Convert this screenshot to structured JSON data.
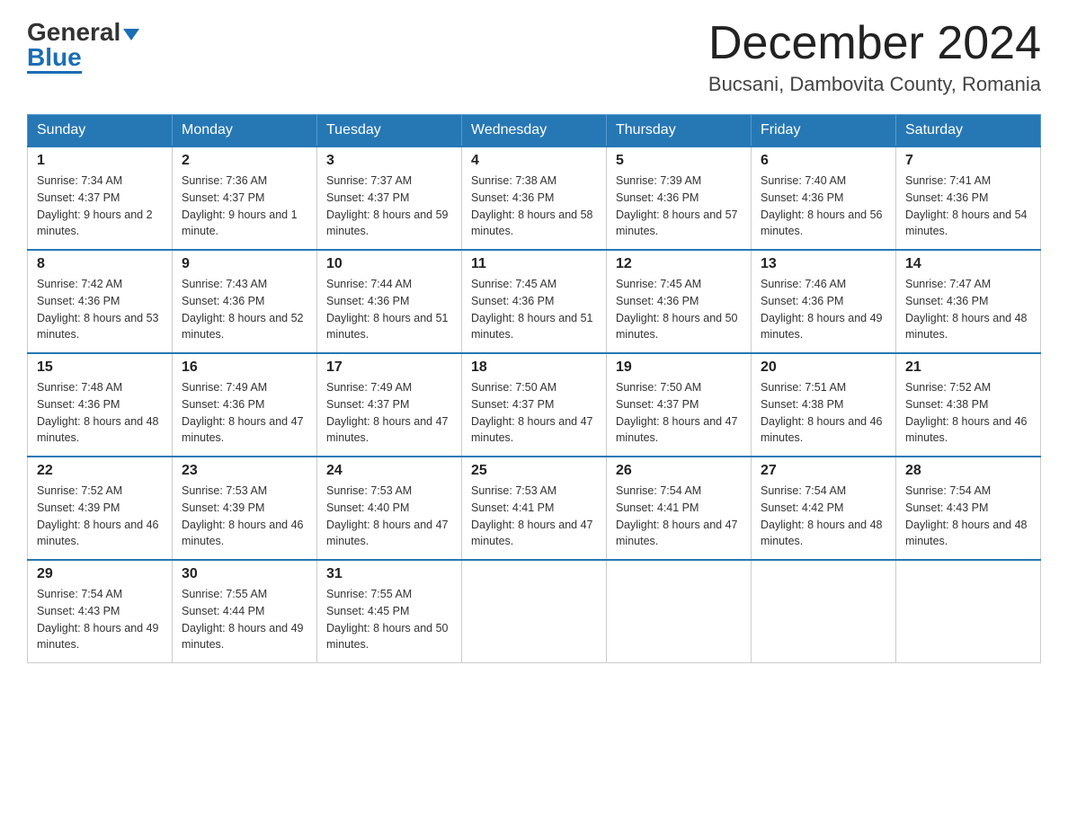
{
  "header": {
    "logo_general": "General",
    "logo_blue": "Blue",
    "month_title": "December 2024",
    "location": "Bucsani, Dambovita County, Romania"
  },
  "days_of_week": [
    "Sunday",
    "Monday",
    "Tuesday",
    "Wednesday",
    "Thursday",
    "Friday",
    "Saturday"
  ],
  "weeks": [
    [
      {
        "day": "1",
        "sunrise": "7:34 AM",
        "sunset": "4:37 PM",
        "daylight": "9 hours and 2 minutes."
      },
      {
        "day": "2",
        "sunrise": "7:36 AM",
        "sunset": "4:37 PM",
        "daylight": "9 hours and 1 minute."
      },
      {
        "day": "3",
        "sunrise": "7:37 AM",
        "sunset": "4:37 PM",
        "daylight": "8 hours and 59 minutes."
      },
      {
        "day": "4",
        "sunrise": "7:38 AM",
        "sunset": "4:36 PM",
        "daylight": "8 hours and 58 minutes."
      },
      {
        "day": "5",
        "sunrise": "7:39 AM",
        "sunset": "4:36 PM",
        "daylight": "8 hours and 57 minutes."
      },
      {
        "day": "6",
        "sunrise": "7:40 AM",
        "sunset": "4:36 PM",
        "daylight": "8 hours and 56 minutes."
      },
      {
        "day": "7",
        "sunrise": "7:41 AM",
        "sunset": "4:36 PM",
        "daylight": "8 hours and 54 minutes."
      }
    ],
    [
      {
        "day": "8",
        "sunrise": "7:42 AM",
        "sunset": "4:36 PM",
        "daylight": "8 hours and 53 minutes."
      },
      {
        "day": "9",
        "sunrise": "7:43 AM",
        "sunset": "4:36 PM",
        "daylight": "8 hours and 52 minutes."
      },
      {
        "day": "10",
        "sunrise": "7:44 AM",
        "sunset": "4:36 PM",
        "daylight": "8 hours and 51 minutes."
      },
      {
        "day": "11",
        "sunrise": "7:45 AM",
        "sunset": "4:36 PM",
        "daylight": "8 hours and 51 minutes."
      },
      {
        "day": "12",
        "sunrise": "7:45 AM",
        "sunset": "4:36 PM",
        "daylight": "8 hours and 50 minutes."
      },
      {
        "day": "13",
        "sunrise": "7:46 AM",
        "sunset": "4:36 PM",
        "daylight": "8 hours and 49 minutes."
      },
      {
        "day": "14",
        "sunrise": "7:47 AM",
        "sunset": "4:36 PM",
        "daylight": "8 hours and 48 minutes."
      }
    ],
    [
      {
        "day": "15",
        "sunrise": "7:48 AM",
        "sunset": "4:36 PM",
        "daylight": "8 hours and 48 minutes."
      },
      {
        "day": "16",
        "sunrise": "7:49 AM",
        "sunset": "4:36 PM",
        "daylight": "8 hours and 47 minutes."
      },
      {
        "day": "17",
        "sunrise": "7:49 AM",
        "sunset": "4:37 PM",
        "daylight": "8 hours and 47 minutes."
      },
      {
        "day": "18",
        "sunrise": "7:50 AM",
        "sunset": "4:37 PM",
        "daylight": "8 hours and 47 minutes."
      },
      {
        "day": "19",
        "sunrise": "7:50 AM",
        "sunset": "4:37 PM",
        "daylight": "8 hours and 47 minutes."
      },
      {
        "day": "20",
        "sunrise": "7:51 AM",
        "sunset": "4:38 PM",
        "daylight": "8 hours and 46 minutes."
      },
      {
        "day": "21",
        "sunrise": "7:52 AM",
        "sunset": "4:38 PM",
        "daylight": "8 hours and 46 minutes."
      }
    ],
    [
      {
        "day": "22",
        "sunrise": "7:52 AM",
        "sunset": "4:39 PM",
        "daylight": "8 hours and 46 minutes."
      },
      {
        "day": "23",
        "sunrise": "7:53 AM",
        "sunset": "4:39 PM",
        "daylight": "8 hours and 46 minutes."
      },
      {
        "day": "24",
        "sunrise": "7:53 AM",
        "sunset": "4:40 PM",
        "daylight": "8 hours and 47 minutes."
      },
      {
        "day": "25",
        "sunrise": "7:53 AM",
        "sunset": "4:41 PM",
        "daylight": "8 hours and 47 minutes."
      },
      {
        "day": "26",
        "sunrise": "7:54 AM",
        "sunset": "4:41 PM",
        "daylight": "8 hours and 47 minutes."
      },
      {
        "day": "27",
        "sunrise": "7:54 AM",
        "sunset": "4:42 PM",
        "daylight": "8 hours and 48 minutes."
      },
      {
        "day": "28",
        "sunrise": "7:54 AM",
        "sunset": "4:43 PM",
        "daylight": "8 hours and 48 minutes."
      }
    ],
    [
      {
        "day": "29",
        "sunrise": "7:54 AM",
        "sunset": "4:43 PM",
        "daylight": "8 hours and 49 minutes."
      },
      {
        "day": "30",
        "sunrise": "7:55 AM",
        "sunset": "4:44 PM",
        "daylight": "8 hours and 49 minutes."
      },
      {
        "day": "31",
        "sunrise": "7:55 AM",
        "sunset": "4:45 PM",
        "daylight": "8 hours and 50 minutes."
      },
      null,
      null,
      null,
      null
    ]
  ]
}
